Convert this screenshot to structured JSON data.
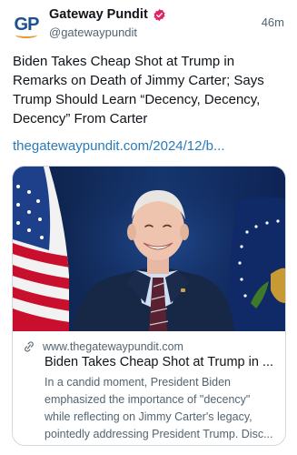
{
  "account": {
    "display_name": "Gateway Pundit",
    "handle": "@gatewaypundit",
    "avatar_text": "GP",
    "verified_color": "#e0245e"
  },
  "post": {
    "timestamp": "46m",
    "text": "Biden Takes Cheap Shot at Trump in Remarks on Death of Jimmy Carter; Says Trump Should Learn “Decency, Decency, Decency” From Carter",
    "link_text": "thegatewaypundit.com/2024/12/b..."
  },
  "link_card": {
    "domain": "www.thegatewaypundit.com",
    "title": "Biden Takes Cheap Shot at Trump in ...",
    "description": "In a candid moment, President Biden emphasized the importance of \"decency\" while reflecting on Jimmy Carter's legacy, pointedly addressing President Trump. Disc...",
    "link_icon": "link-icon"
  },
  "colors": {
    "link": "#2a7bb8",
    "secondary_text": "#536471",
    "border": "#cfd9de"
  }
}
